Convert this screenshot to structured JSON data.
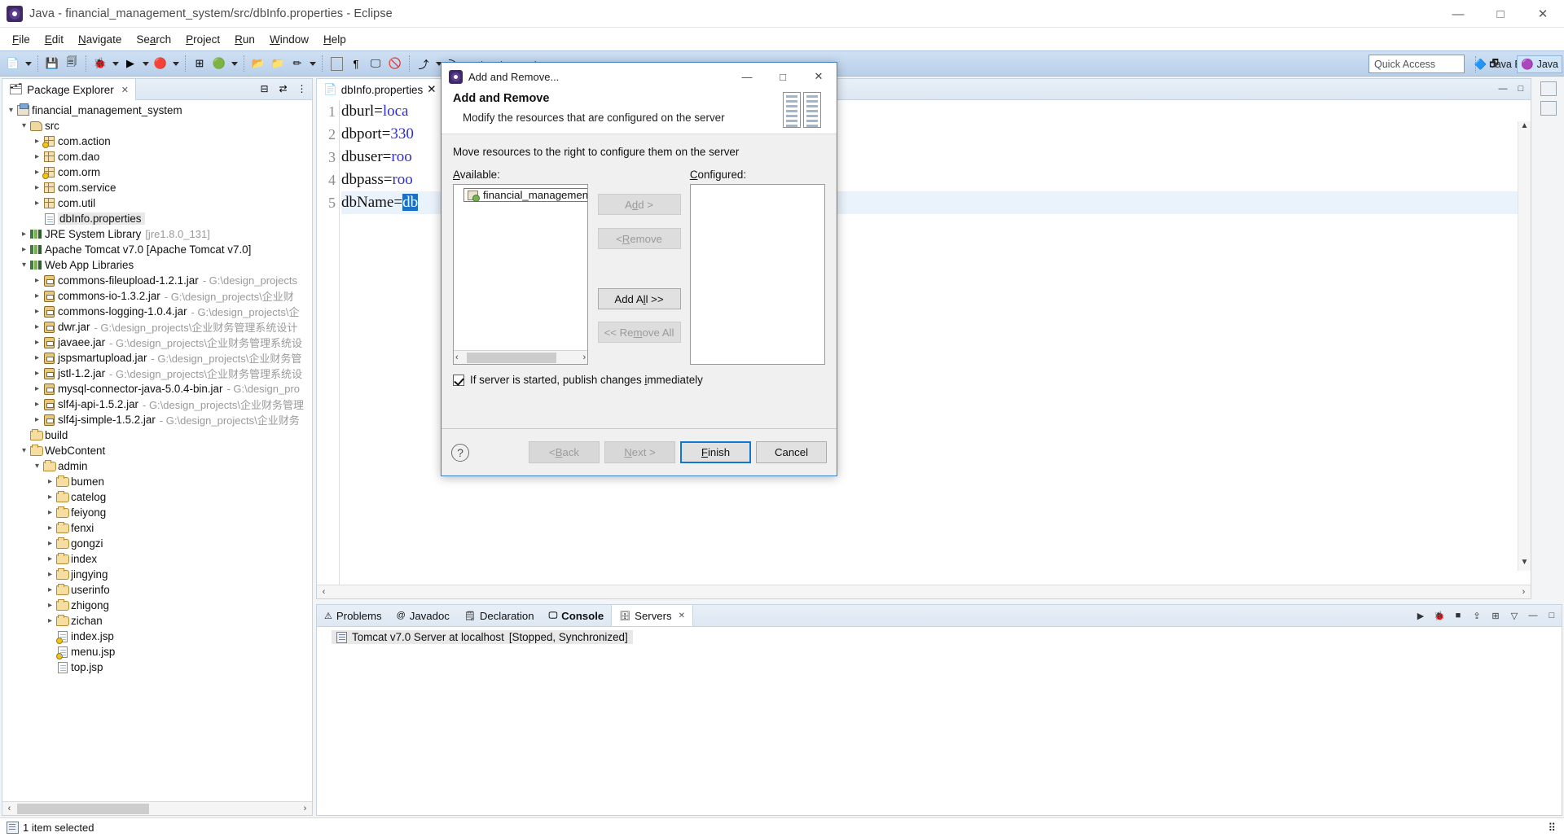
{
  "window": {
    "title": "Java - financial_management_system/src/dbInfo.properties - Eclipse",
    "app_icon": "eclipse-icon",
    "minimize": "—",
    "maximize": "□",
    "close": "✕"
  },
  "menu": {
    "items": [
      {
        "label": "File",
        "mnemonic": "F"
      },
      {
        "label": "Edit",
        "mnemonic": "E"
      },
      {
        "label": "Navigate",
        "mnemonic": "N"
      },
      {
        "label": "Search",
        "mnemonic": "a"
      },
      {
        "label": "Project",
        "mnemonic": "P"
      },
      {
        "label": "Run",
        "mnemonic": "R"
      },
      {
        "label": "Window",
        "mnemonic": "W"
      },
      {
        "label": "Help",
        "mnemonic": "H"
      }
    ]
  },
  "toolbar": {
    "quick_access_placeholder": "Quick Access",
    "open_perspective_label": "",
    "perspectives": [
      {
        "label": "Java EE",
        "active": false
      },
      {
        "label": "Java",
        "active": true
      }
    ]
  },
  "package_explorer": {
    "tab_label": "Package Explorer",
    "close_glyph": "✕",
    "tree": [
      {
        "indent": 0,
        "twisty": "expanded",
        "icon": "project-icon",
        "label": "financial_management_system",
        "path": "",
        "selected": false
      },
      {
        "indent": 1,
        "twisty": "expanded",
        "icon": "source-folder-icon",
        "label": "src",
        "path": "",
        "selected": false
      },
      {
        "indent": 2,
        "twisty": "collapsed",
        "icon": "package-warning-icon",
        "label": "com.action",
        "path": "",
        "selected": false
      },
      {
        "indent": 2,
        "twisty": "collapsed",
        "icon": "package-icon",
        "label": "com.dao",
        "path": "",
        "selected": false
      },
      {
        "indent": 2,
        "twisty": "collapsed",
        "icon": "package-warning-icon",
        "label": "com.orm",
        "path": "",
        "selected": false
      },
      {
        "indent": 2,
        "twisty": "collapsed",
        "icon": "package-icon",
        "label": "com.service",
        "path": "",
        "selected": false
      },
      {
        "indent": 2,
        "twisty": "collapsed",
        "icon": "package-icon",
        "label": "com.util",
        "path": "",
        "selected": false
      },
      {
        "indent": 2,
        "twisty": "none",
        "icon": "properties-file-icon",
        "label": "dbInfo.properties",
        "path": "",
        "selected": true
      },
      {
        "indent": 1,
        "twisty": "collapsed",
        "icon": "library-icon",
        "label": "JRE System Library",
        "path": "[jre1.8.0_131]",
        "selected": false
      },
      {
        "indent": 1,
        "twisty": "collapsed",
        "icon": "library-icon",
        "label": "Apache Tomcat v7.0 [Apache Tomcat v7.0]",
        "path": "",
        "selected": false
      },
      {
        "indent": 1,
        "twisty": "expanded",
        "icon": "library-icon",
        "label": "Web App Libraries",
        "path": "",
        "selected": false
      },
      {
        "indent": 2,
        "twisty": "collapsed",
        "icon": "jar-icon",
        "label": "commons-fileupload-1.2.1.jar",
        "path": "- G:\\design_projects",
        "selected": false
      },
      {
        "indent": 2,
        "twisty": "collapsed",
        "icon": "jar-icon",
        "label": "commons-io-1.3.2.jar",
        "path": "- G:\\design_projects\\企业财",
        "selected": false
      },
      {
        "indent": 2,
        "twisty": "collapsed",
        "icon": "jar-icon",
        "label": "commons-logging-1.0.4.jar",
        "path": "- G:\\design_projects\\企",
        "selected": false
      },
      {
        "indent": 2,
        "twisty": "collapsed",
        "icon": "jar-icon",
        "label": "dwr.jar",
        "path": "- G:\\design_projects\\企业财务管理系统设计",
        "selected": false
      },
      {
        "indent": 2,
        "twisty": "collapsed",
        "icon": "jar-icon",
        "label": "javaee.jar",
        "path": "- G:\\design_projects\\企业财务管理系统设",
        "selected": false
      },
      {
        "indent": 2,
        "twisty": "collapsed",
        "icon": "jar-icon",
        "label": "jspsmartupload.jar",
        "path": "- G:\\design_projects\\企业财务管",
        "selected": false
      },
      {
        "indent": 2,
        "twisty": "collapsed",
        "icon": "jar-icon",
        "label": "jstl-1.2.jar",
        "path": "- G:\\design_projects\\企业财务管理系统设",
        "selected": false
      },
      {
        "indent": 2,
        "twisty": "collapsed",
        "icon": "jar-icon",
        "label": "mysql-connector-java-5.0.4-bin.jar",
        "path": "- G:\\design_pro",
        "selected": false
      },
      {
        "indent": 2,
        "twisty": "collapsed",
        "icon": "jar-icon",
        "label": "slf4j-api-1.5.2.jar",
        "path": "- G:\\design_projects\\企业财务管理",
        "selected": false
      },
      {
        "indent": 2,
        "twisty": "collapsed",
        "icon": "jar-icon",
        "label": "slf4j-simple-1.5.2.jar",
        "path": "- G:\\design_projects\\企业财务",
        "selected": false
      },
      {
        "indent": 1,
        "twisty": "none",
        "icon": "folder-icon",
        "label": "build",
        "path": "",
        "selected": false
      },
      {
        "indent": 1,
        "twisty": "expanded",
        "icon": "web-folder-icon",
        "label": "WebContent",
        "path": "",
        "selected": false
      },
      {
        "indent": 2,
        "twisty": "expanded",
        "icon": "folder-icon",
        "label": "admin",
        "path": "",
        "selected": false
      },
      {
        "indent": 3,
        "twisty": "collapsed",
        "icon": "folder-icon",
        "label": "bumen",
        "path": "",
        "selected": false
      },
      {
        "indent": 3,
        "twisty": "collapsed",
        "icon": "folder-icon",
        "label": "catelog",
        "path": "",
        "selected": false
      },
      {
        "indent": 3,
        "twisty": "collapsed",
        "icon": "folder-icon",
        "label": "feiyong",
        "path": "",
        "selected": false
      },
      {
        "indent": 3,
        "twisty": "collapsed",
        "icon": "folder-icon",
        "label": "fenxi",
        "path": "",
        "selected": false
      },
      {
        "indent": 3,
        "twisty": "collapsed",
        "icon": "folder-icon",
        "label": "gongzi",
        "path": "",
        "selected": false
      },
      {
        "indent": 3,
        "twisty": "collapsed",
        "icon": "folder-icon",
        "label": "index",
        "path": "",
        "selected": false
      },
      {
        "indent": 3,
        "twisty": "collapsed",
        "icon": "folder-icon",
        "label": "jingying",
        "path": "",
        "selected": false
      },
      {
        "indent": 3,
        "twisty": "collapsed",
        "icon": "folder-icon",
        "label": "userinfo",
        "path": "",
        "selected": false
      },
      {
        "indent": 3,
        "twisty": "collapsed",
        "icon": "folder-icon",
        "label": "zhigong",
        "path": "",
        "selected": false
      },
      {
        "indent": 3,
        "twisty": "collapsed",
        "icon": "folder-icon",
        "label": "zichan",
        "path": "",
        "selected": false
      },
      {
        "indent": 3,
        "twisty": "none",
        "icon": "jsp-warning-icon",
        "label": "index.jsp",
        "path": "",
        "selected": false
      },
      {
        "indent": 3,
        "twisty": "none",
        "icon": "jsp-warning-icon",
        "label": "menu.jsp",
        "path": "",
        "selected": false
      },
      {
        "indent": 3,
        "twisty": "none",
        "icon": "jsp-icon",
        "label": "top.jsp",
        "path": "",
        "selected": false
      }
    ]
  },
  "editor": {
    "tab_label": "dbInfo.properties",
    "close_glyph": "✕",
    "lines": [
      {
        "no": "1",
        "prefix": "dburl=",
        "value": "loca",
        "selected": false,
        "current": false
      },
      {
        "no": "2",
        "prefix": "dbport=",
        "value": "330",
        "selected": false,
        "current": false
      },
      {
        "no": "3",
        "prefix": "dbuser=",
        "value": "roo",
        "selected": false,
        "current": false
      },
      {
        "no": "4",
        "prefix": "dbpass=",
        "value": "roo",
        "selected": false,
        "current": false
      },
      {
        "no": "5",
        "prefix": "dbName=",
        "value": "db",
        "selected": true,
        "current": true
      }
    ]
  },
  "bottom_panel": {
    "tabs": [
      {
        "label": "Problems",
        "icon": "problems-icon",
        "active": false,
        "bold": false
      },
      {
        "label": "Javadoc",
        "icon": "javadoc-icon",
        "active": false,
        "bold": false
      },
      {
        "label": "Declaration",
        "icon": "declaration-icon",
        "active": false,
        "bold": false
      },
      {
        "label": "Console",
        "icon": "console-icon",
        "active": false,
        "bold": true
      },
      {
        "label": "Servers",
        "icon": "servers-icon",
        "active": true,
        "bold": false
      }
    ],
    "close_glyph": "✕",
    "server_row": {
      "icon": "server-icon",
      "name": "Tomcat v7.0 Server at localhost",
      "status": "[Stopped, Synchronized]"
    }
  },
  "status_bar": {
    "icon": "selection-icon",
    "text": "1 item selected"
  },
  "dialog": {
    "window_title": "Add and Remove...",
    "icon": "eclipse-icon",
    "minimize": "—",
    "maximize": "□",
    "close": "✕",
    "heading": "Add and Remove",
    "subheading": "Modify the resources that are configured on the server",
    "instruction": "Move resources to the right to configure them on the server",
    "available_label": "Available:",
    "available_mnemonic": "A",
    "configured_label": "Configured:",
    "configured_mnemonic": "C",
    "available_items": [
      {
        "label": "financial_management_system",
        "icon": "project-module-icon"
      }
    ],
    "configured_items": [],
    "mid_buttons": [
      {
        "label_pre": "A",
        "label_mn": "d",
        "label_post": "d >",
        "full": "Add >",
        "enabled": false,
        "name": "add-button"
      },
      {
        "label_pre": "< ",
        "label_mn": "R",
        "label_post": "emove",
        "full": "< Remove",
        "enabled": false,
        "name": "remove-button"
      },
      {
        "label_pre": "Add A",
        "label_mn": "l",
        "label_post": "l >>",
        "full": "Add All >>",
        "enabled": true,
        "name": "add-all-button"
      },
      {
        "label_pre": "<< Re",
        "label_mn": "m",
        "label_post": "ove All",
        "full": "<< Remove All",
        "enabled": false,
        "name": "remove-all-button"
      }
    ],
    "checkbox": {
      "checked": true,
      "pre": "If server is started, publish changes ",
      "mn": "i",
      "post": "mmediately",
      "full": "If server is started, publish changes immediately"
    },
    "help_glyph": "?",
    "footer_buttons": [
      {
        "full": "< Back",
        "pre": "< ",
        "mn": "B",
        "post": "ack",
        "state": "disabled",
        "name": "back-button"
      },
      {
        "full": "Next >",
        "pre": "",
        "mn": "N",
        "post": "ext >",
        "state": "disabled",
        "name": "next-button"
      },
      {
        "full": "Finish",
        "pre": "",
        "mn": "F",
        "post": "inish",
        "state": "default",
        "name": "finish-button"
      },
      {
        "full": "Cancel",
        "pre": "",
        "mn": "",
        "post": "Cancel",
        "state": "enabled",
        "name": "cancel-button"
      }
    ],
    "scroll": {
      "left_arrow": "‹",
      "right_arrow": "›"
    }
  },
  "colors": {
    "accent_blue": "#1177d1",
    "selection_blue": "#1a72c8",
    "toolbar_blue": "#c4d8ef",
    "value_purple": "#2e2ed4"
  }
}
